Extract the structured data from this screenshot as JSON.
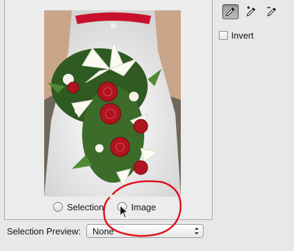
{
  "image_mode": {
    "selection_label": "Selection",
    "image_label": "Image",
    "selected": "Image"
  },
  "tools": [
    {
      "name": "eyedropper",
      "active": true
    },
    {
      "name": "eyedropper-plus",
      "active": false
    },
    {
      "name": "eyedropper-minus",
      "active": false
    }
  ],
  "invert": {
    "label": "Invert",
    "checked": false
  },
  "selection_preview": {
    "label": "Selection Preview:",
    "value": "None"
  },
  "colors": {
    "annotation": "#e0101a",
    "accent": "#c8102e"
  }
}
